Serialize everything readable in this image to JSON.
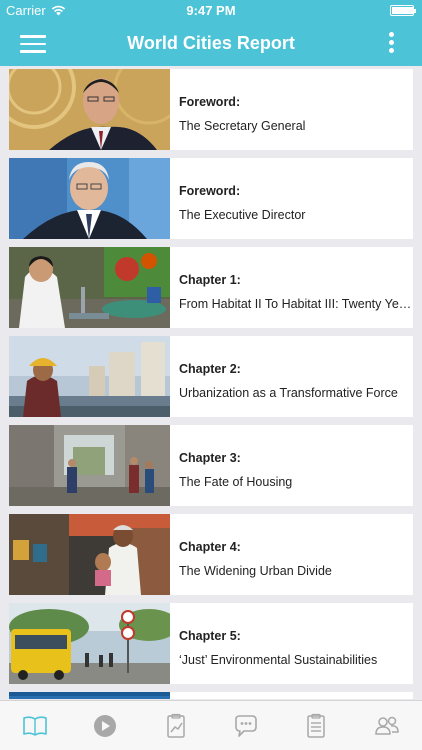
{
  "status": {
    "carrier": "Carrier",
    "time": "9:47 PM",
    "battery_level": 0.95
  },
  "header": {
    "title": "World Cities Report",
    "menu_icon": "hamburger-menu-icon",
    "more_icon": "vertical-ellipsis-icon"
  },
  "items": [
    {
      "label": "Foreword:",
      "subtitle": "The Secretary General"
    },
    {
      "label": "Foreword:",
      "subtitle": "The Executive Director"
    },
    {
      "label": "Chapter 1:",
      "subtitle": "From Habitat II To Habitat III: Twenty Years of Urban Development"
    },
    {
      "label": "Chapter 2:",
      "subtitle": "Urbanization as a Transformative Force"
    },
    {
      "label": "Chapter 3:",
      "subtitle": "The Fate of Housing"
    },
    {
      "label": "Chapter 4:",
      "subtitle": "The Widening Urban Divide"
    },
    {
      "label": "Chapter 5:",
      "subtitle": "‘Just’ Environmental Sustainabilities"
    }
  ],
  "tabs": [
    {
      "icon": "book-icon",
      "active": true
    },
    {
      "icon": "play-icon",
      "active": false
    },
    {
      "icon": "chart-clipboard-icon",
      "active": false
    },
    {
      "icon": "chat-bubble-icon",
      "active": false
    },
    {
      "icon": "checklist-icon",
      "active": false
    },
    {
      "icon": "people-icon",
      "active": false
    }
  ],
  "colors": {
    "accent": "#4cc3d6",
    "tab_active": "#4cc3d6",
    "tab_inactive": "#a8a8a8"
  }
}
